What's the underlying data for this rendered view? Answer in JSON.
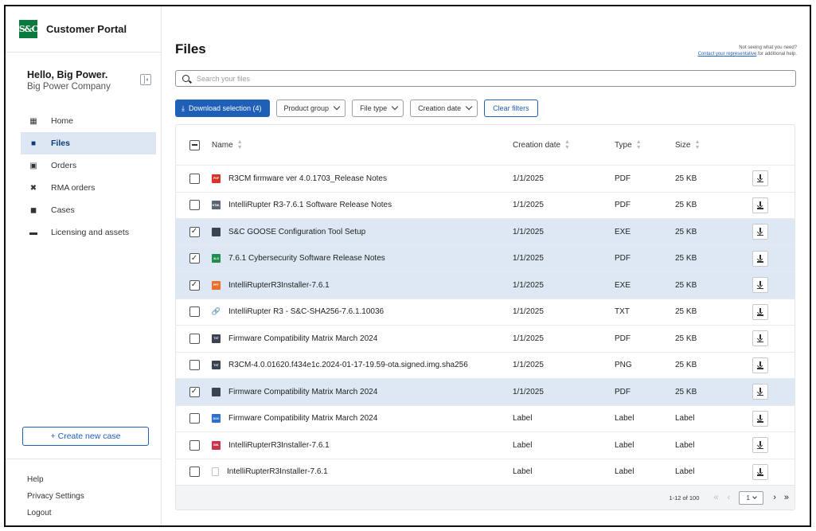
{
  "app": {
    "name": "Customer Portal",
    "logo_text": "S&C"
  },
  "user": {
    "greeting": "Hello, Big Power.",
    "company": "Big Power Company"
  },
  "nav": [
    {
      "label": "Home",
      "icon": "home-icon",
      "active": false
    },
    {
      "label": "Files",
      "icon": "folder-icon",
      "active": true
    },
    {
      "label": "Orders",
      "icon": "orders-icon",
      "active": false
    },
    {
      "label": "RMA orders",
      "icon": "tools-icon",
      "active": false
    },
    {
      "label": "Cases",
      "icon": "briefcase-icon",
      "active": false
    },
    {
      "label": "Licensing and assets",
      "icon": "license-icon",
      "active": false
    }
  ],
  "sidebar": {
    "create_case_label": "+ Create new case",
    "footer": [
      "Help",
      "Privacy Settings",
      "Logout"
    ]
  },
  "page": {
    "title": "Files",
    "help_text": "Not seeing what you need?",
    "help_link": "Contact your representative",
    "help_suffix": " for additional help."
  },
  "search": {
    "placeholder": "Search your files"
  },
  "filters": {
    "download_label": "Download selection (4)",
    "product_group": "Product group",
    "file_type": "File type",
    "creation_date": "Creation date",
    "clear": "Clear filters"
  },
  "table": {
    "columns": {
      "name": "Name",
      "date": "Creation date",
      "type": "Type",
      "size": "Size"
    },
    "rows": [
      {
        "name": "R3CM firmware ver 4.0.1703_Release Notes",
        "date": "1/1/2025",
        "type": "PDF",
        "size": "25 KB",
        "selected": false,
        "icon": "pdf"
      },
      {
        "name": "IntelliRupter R3-7.6.1 Software Release Notes",
        "date": "1/1/2025",
        "type": "PDF",
        "size": "25 KB",
        "selected": false,
        "icon": "html"
      },
      {
        "name": "S&C GOOSE Configuration Tool Setup",
        "date": "1/1/2025",
        "type": "EXE",
        "size": "25 KB",
        "selected": true,
        "icon": "exe"
      },
      {
        "name": "7.6.1 Cybersecurity Software Release Notes",
        "date": "1/1/2025",
        "type": "PDF",
        "size": "25 KB",
        "selected": true,
        "icon": "xls"
      },
      {
        "name": "IntelliRupterR3Installer-7.6.1",
        "date": "1/1/2025",
        "type": "EXE",
        "size": "25 KB",
        "selected": true,
        "icon": "ppt"
      },
      {
        "name": "IntelliRupter R3 - S&C-SHA256-7.6.1.10036",
        "date": "1/1/2025",
        "type": "TXT",
        "size": "25 KB",
        "selected": false,
        "icon": "link"
      },
      {
        "name": "Firmware Compatibility Matrix March 2024",
        "date": "1/1/2025",
        "type": "PDF",
        "size": "25 KB",
        "selected": false,
        "icon": "txt"
      },
      {
        "name": "R3CM-4.0.01620.f434e1c.2024-01-17-19.59-ota.signed.img.sha256",
        "date": "1/1/2025",
        "type": "PNG",
        "size": "25 KB",
        "selected": false,
        "icon": "txt"
      },
      {
        "name": "Firmware Compatibility Matrix March 2024",
        "date": "1/1/2025",
        "type": "PDF",
        "size": "25 KB",
        "selected": true,
        "icon": "folder"
      },
      {
        "name": "Firmware Compatibility Matrix March 2024",
        "date": "Label",
        "type": "Label",
        "size": "Label",
        "selected": false,
        "icon": "doc"
      },
      {
        "name": "IntelliRupterR3Installer-7.6.1",
        "date": "Label",
        "type": "Label",
        "size": "Label",
        "selected": false,
        "icon": "xml"
      },
      {
        "name": "IntelliRupterR3Installer-7.6.1",
        "date": "Label",
        "type": "Label",
        "size": "Label",
        "selected": false,
        "icon": "blank"
      }
    ]
  },
  "pager": {
    "range": "1-12 of 100",
    "page": "1"
  },
  "colors": {
    "primary": "#1e5fb8",
    "selected_row": "#dde8f4",
    "active_nav": "#dce7f3",
    "brand_green": "#0b7a3e"
  }
}
